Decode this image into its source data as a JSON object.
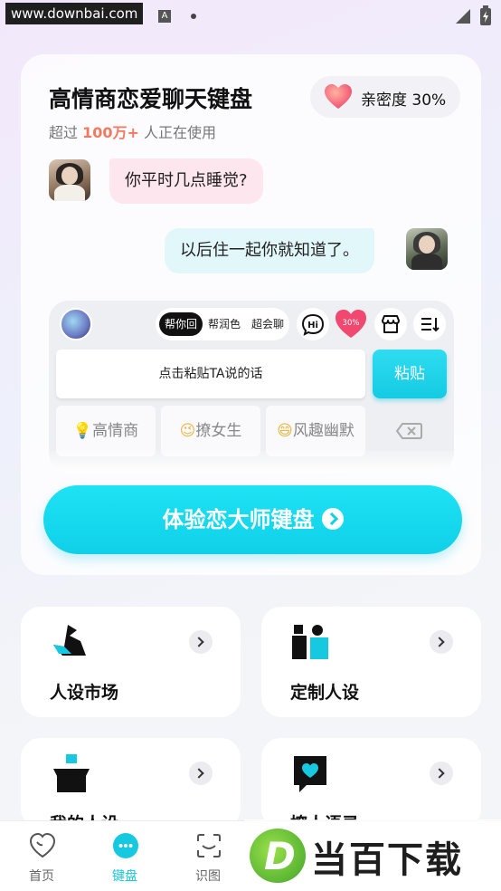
{
  "status_bar": {
    "watermark_url": "www.downbai.com",
    "notification_letter": "A"
  },
  "hero": {
    "title": "高情商恋爱聊天键盘",
    "intimacy_label": "亲密度 30%",
    "subtitle_prefix": "超过 ",
    "subtitle_highlight": "100万+",
    "subtitle_suffix": " 人正在使用",
    "chat_left": "你平时几点睡觉?",
    "chat_right": "以后住一起你就知道了。"
  },
  "keyboard_preview": {
    "tabs": [
      "帮你回",
      "帮润色",
      "超会聊"
    ],
    "hi_label": "Hi",
    "heart_badge": "30%",
    "input_placeholder": "点击粘贴TA说的话",
    "paste_label": "粘贴",
    "keys": [
      {
        "emoji": "💡",
        "label": "高情商"
      },
      {
        "emoji": "😉",
        "label": "撩女生"
      },
      {
        "emoji": "😄",
        "label": "风趣幽默"
      }
    ]
  },
  "cta": {
    "label": "体验恋大师键盘"
  },
  "features": [
    {
      "label": "人设市场",
      "icon": "swan-icon"
    },
    {
      "label": "定制人设",
      "icon": "people-icon"
    },
    {
      "label": "我的人设",
      "icon": "box-person-icon"
    },
    {
      "label": "撩人语录",
      "icon": "chat-heart-icon"
    }
  ],
  "bottom_nav": [
    {
      "label": "首页",
      "icon": "heart-outline-icon"
    },
    {
      "label": "键盘",
      "icon": "keyboard-dots-icon"
    },
    {
      "label": "识图",
      "icon": "scan-icon"
    }
  ],
  "brand_watermark": {
    "text": "当百下载"
  },
  "colors": {
    "accent": "#16c8e0",
    "highlight": "#f07a60",
    "heart": "#f0486e"
  }
}
